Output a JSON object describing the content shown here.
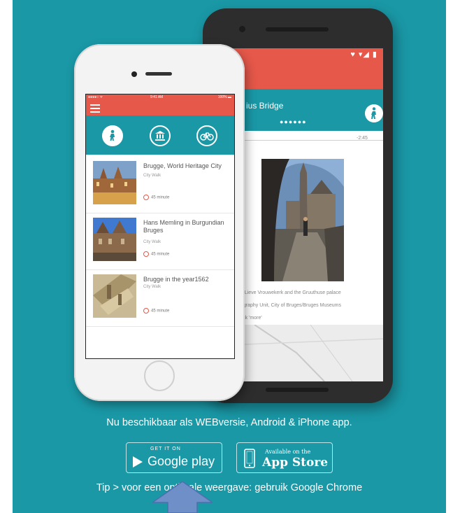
{
  "colors": {
    "teal": "#1a98a6",
    "coral": "#e5584a",
    "arrow": "#6e8fc8"
  },
  "android": {
    "status_icons": "♥ ▾◢ ▮",
    "title": "ius Bridge",
    "dots": "●●●●●●",
    "time": "-2:45",
    "captions": [
      "e Lieve Vrouwekerk and the Gruuthuse palace",
      "ography Unit, City of Bruges/Bruges Museums",
      "lick 'more'"
    ]
  },
  "iphone": {
    "status_left": "●●●●○ ᯤ",
    "status_time": "9:41 AM",
    "status_right": "100% ▬",
    "tabs": [
      {
        "name": "walk",
        "icon": "walk-icon"
      },
      {
        "name": "museum",
        "icon": "museum-icon"
      },
      {
        "name": "bike",
        "icon": "bike-icon"
      }
    ],
    "items": [
      {
        "title": "Brugge, World Heritage City",
        "subtitle": "City Walk",
        "duration": "45 minute"
      },
      {
        "title": "Hans Memling in Burgundian Bruges",
        "subtitle": "City Walk",
        "duration": "45 minute"
      },
      {
        "title": "Brugge in the year1562",
        "subtitle": "City Walk",
        "duration": "45 minute"
      }
    ]
  },
  "headline": "Nu beschikbaar als WEBversie, Android & iPhone app.",
  "google_play": {
    "small": "GET IT ON",
    "big": "Google play"
  },
  "app_store": {
    "small": "Available on the",
    "big": "App Store"
  },
  "tip": "Tip > voor een optimale weergave: gebruik Google Chrome"
}
